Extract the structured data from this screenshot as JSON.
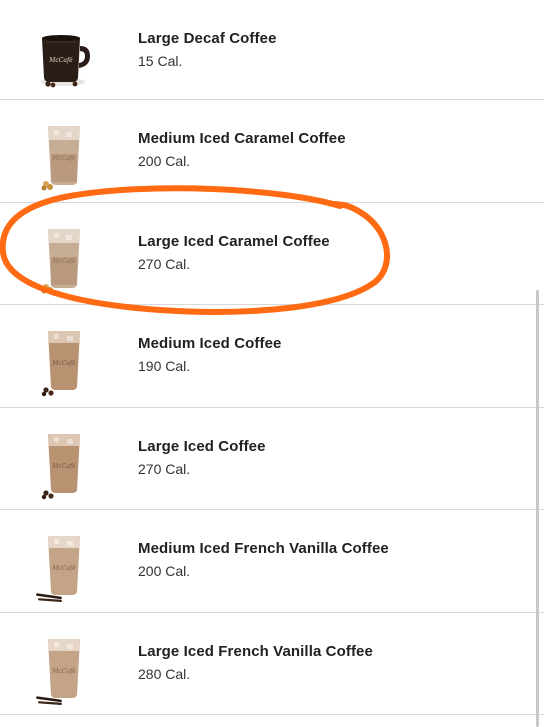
{
  "menu": {
    "items": [
      {
        "name": "Large Decaf Coffee",
        "calories": "15 Cal.",
        "type": "hot",
        "icon": "hot-coffee-mug-icon"
      },
      {
        "name": "Medium Iced Caramel Coffee",
        "calories": "200 Cal.",
        "type": "caramel",
        "icon": "iced-caramel-coffee-icon"
      },
      {
        "name": "Large Iced Caramel Coffee",
        "calories": "270 Cal.",
        "type": "caramel",
        "icon": "iced-caramel-coffee-icon"
      },
      {
        "name": "Medium Iced Coffee",
        "calories": "190 Cal.",
        "type": "iced",
        "icon": "iced-coffee-icon"
      },
      {
        "name": "Large Iced Coffee",
        "calories": "270 Cal.",
        "type": "iced",
        "icon": "iced-coffee-icon"
      },
      {
        "name": "Medium Iced French Vanilla Coffee",
        "calories": "200 Cal.",
        "type": "vanilla",
        "icon": "iced-vanilla-coffee-icon"
      },
      {
        "name": "Large Iced French Vanilla Coffee",
        "calories": "280 Cal.",
        "type": "vanilla",
        "icon": "iced-vanilla-coffee-icon"
      }
    ]
  },
  "annotation": {
    "highlighted_item_index": 2,
    "color": "#ff6a13"
  },
  "colors": {
    "divider": "#d9d9d9",
    "text_primary": "#222222",
    "text_secondary": "#333333"
  }
}
